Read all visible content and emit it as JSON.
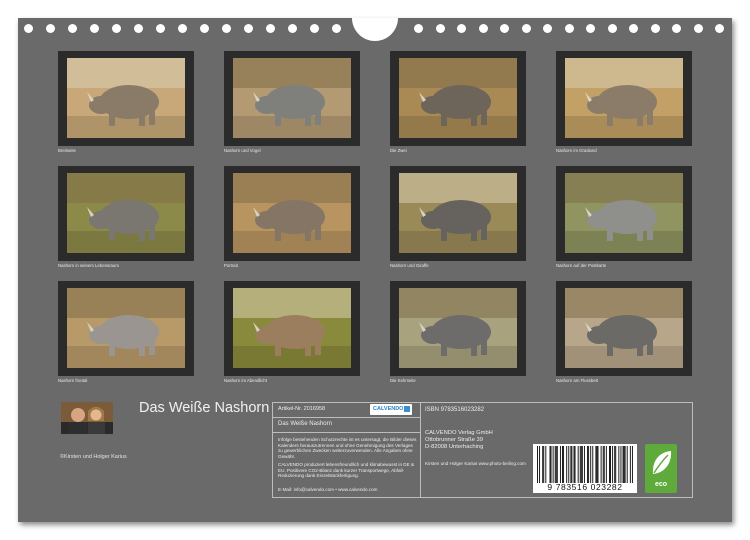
{
  "calendar": {
    "title": "Das Weiße Nashorn",
    "copyright": "©Kirsten und Holger Karius"
  },
  "thumbnails": [
    {
      "caption": "Breitseite",
      "bg": "#c8a878",
      "fg": "#8a7a68"
    },
    {
      "caption": "Nashorn und Vogel",
      "bg": "#b49a72",
      "fg": "#7f7f7c"
    },
    {
      "caption": "Die Zwei",
      "bg": "#a98a55",
      "fg": "#6e655a"
    },
    {
      "caption": "Nashorn im Grasland",
      "bg": "#c2a066",
      "fg": "#8a7c68"
    },
    {
      "caption": "Nashorn in seinem Lebensraum",
      "bg": "#8c8a48",
      "fg": "#7a7770"
    },
    {
      "caption": "Portrait",
      "bg": "#b89460",
      "fg": "#857565"
    },
    {
      "caption": "Nashorn und Giraffe",
      "bg": "#9a8a58",
      "fg": "#66635e"
    },
    {
      "caption": "Nashorn auf der Postkarte",
      "bg": "#8f9460",
      "fg": "#8f8f8c"
    },
    {
      "caption": "Nashorn frontal",
      "bg": "#b89a68",
      "fg": "#9a9590"
    },
    {
      "caption": "Nashorn im Abendlicht",
      "bg": "#8a8a3c",
      "fg": "#9a7e5e"
    },
    {
      "caption": "Die Kehrseite",
      "bg": "#a9a27e",
      "fg": "#6e6c6a"
    },
    {
      "caption": "Nashorn am Flussbett",
      "bg": "#b8a68a",
      "fg": "#6b6a66"
    }
  ],
  "info": {
    "article": "Artikel-Nr. 2016958",
    "title": "Das Weiße Nashorn",
    "legal1": "Infolge bestehenden Schutzrechte ist es untersagt, die Bilder dieses Kalenders herauszutrennen und ohne Genehmigung des Verlages zu gewerblichen Zwecken weiterzuverwenden. Alle Angaben ohne Gewähr.",
    "legal2": "CALVENDO produziert lebensfreundlich und klimabewusst in DE & EU. Positivere CO2-Bilanz dank kurzer Transportwege, Abfall-Reduzierung dank Einzelstückfertigung.",
    "contact": "E-Mail: info@calvendo.com • www.calvendo.com",
    "isbn": "ISBN 9783516023282",
    "publisher1": "CALVENDO Verlag GmbH",
    "publisher2": "Ottobrunner Straße 39",
    "publisher3": "D-82008 Unterhaching",
    "website": "Kirsten und Holger Karius www.photo-beiling.com",
    "logo": "CALVENDO",
    "barcode": "9  783516  023282",
    "eco": "eco"
  }
}
